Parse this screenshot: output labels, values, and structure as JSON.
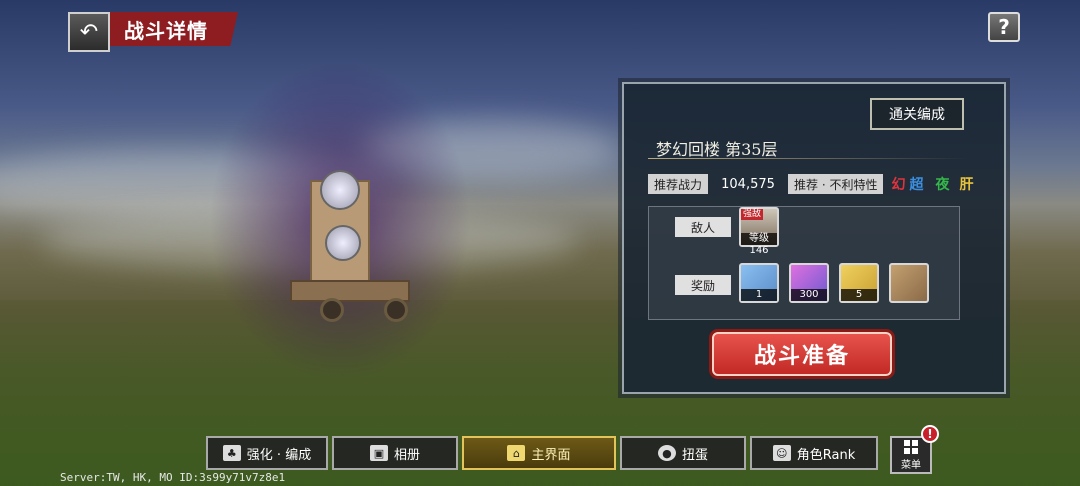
{
  "header": {
    "back_icon": "back-arrow-icon",
    "title": "战斗详情",
    "help_label": "?"
  },
  "panel": {
    "clear_team_label": "通关编成",
    "stage_name": "梦幻回楼 第35层",
    "recommended_power_label": "推荐战力",
    "recommended_power_value": "104,575",
    "disadvantage_label": "推荐 · 不利特性",
    "traits": [
      {
        "text": "幻",
        "color": "#e0343d"
      },
      {
        "text": "超",
        "color": "#3b8fe0"
      },
      {
        "text": "夜",
        "color": "#34b84a"
      },
      {
        "text": "肝",
        "color": "#e8c23a"
      }
    ],
    "enemy_label": "敌人",
    "enemy": {
      "badge": "强敌",
      "level": "等级146"
    },
    "reward_label": "奖励",
    "rewards": [
      {
        "icon": "crystal-shards-icon",
        "count": "1",
        "color": "#5a8ac8"
      },
      {
        "icon": "gem-pile-icon",
        "count": "300",
        "color": "#6a5ad0"
      },
      {
        "icon": "gold-star-icon",
        "count": "5",
        "color": "#c8a030"
      },
      {
        "icon": "treasure-chest-icon",
        "count": "",
        "color": "#8a6a48"
      }
    ],
    "start_label": "战斗准备"
  },
  "nav": {
    "items": [
      {
        "label": "强化 · 编成",
        "icon": "team-icon",
        "active": false
      },
      {
        "label": "相册",
        "icon": "album-icon",
        "active": false
      },
      {
        "label": "主界面",
        "icon": "home-icon",
        "active": true
      },
      {
        "label": "扭蛋",
        "icon": "gacha-icon",
        "active": false
      },
      {
        "label": "角色Rank",
        "icon": "character-icon",
        "active": false
      }
    ],
    "menu_label": "菜单",
    "alert": "!"
  },
  "server_info": "Server:TW, HK, MO ID:3s99y71v7z8e1"
}
